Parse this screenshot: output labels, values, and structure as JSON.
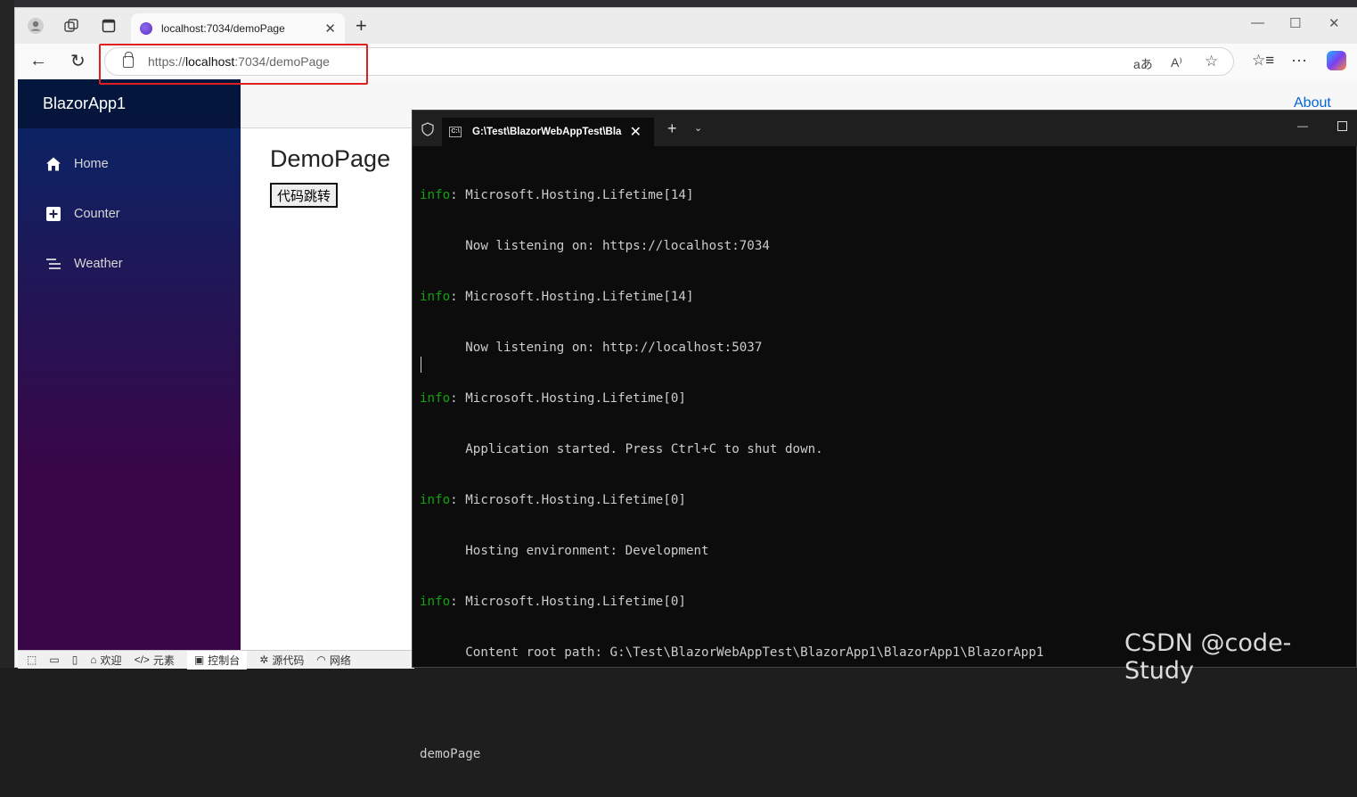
{
  "browser": {
    "tab_title": "localhost:7034/demoPage",
    "url_scheme": "https://",
    "url_host": "localhost",
    "url_rest": ":7034/demoPage"
  },
  "app": {
    "brand": "BlazorApp1",
    "nav": [
      {
        "label": "Home",
        "icon": "home-icon"
      },
      {
        "label": "Counter",
        "icon": "plus-square-icon"
      },
      {
        "label": "Weather",
        "icon": "list-icon"
      }
    ],
    "about": "About",
    "heading": "DemoPage",
    "button": "代码跳转"
  },
  "devtools": {
    "tabs": [
      "欢迎",
      "元素",
      "控制台",
      "源代码",
      "网络"
    ]
  },
  "terminal": {
    "tab_title": "G:\\Test\\BlazorWebAppTest\\Bla",
    "lines": [
      {
        "tag": "info",
        "text": ": Microsoft.Hosting.Lifetime[14]"
      },
      {
        "tag": "",
        "text": "      Now listening on: https://localhost:7034"
      },
      {
        "tag": "info",
        "text": ": Microsoft.Hosting.Lifetime[14]"
      },
      {
        "tag": "",
        "text": "      Now listening on: http://localhost:5037"
      },
      {
        "tag": "info",
        "text": ": Microsoft.Hosting.Lifetime[0]"
      },
      {
        "tag": "",
        "text": "      Application started. Press Ctrl+C to shut down."
      },
      {
        "tag": "info",
        "text": ": Microsoft.Hosting.Lifetime[0]"
      },
      {
        "tag": "",
        "text": "      Hosting environment: Development"
      },
      {
        "tag": "info",
        "text": ": Microsoft.Hosting.Lifetime[0]"
      },
      {
        "tag": "",
        "text": "      Content root path: G:\\Test\\BlazorWebAppTest\\BlazorApp1\\BlazorApp1\\BlazorApp1"
      },
      {
        "tag": "",
        "text": ""
      },
      {
        "tag": "",
        "text": "demoPage"
      }
    ]
  },
  "watermark": "CSDN @code-Study"
}
